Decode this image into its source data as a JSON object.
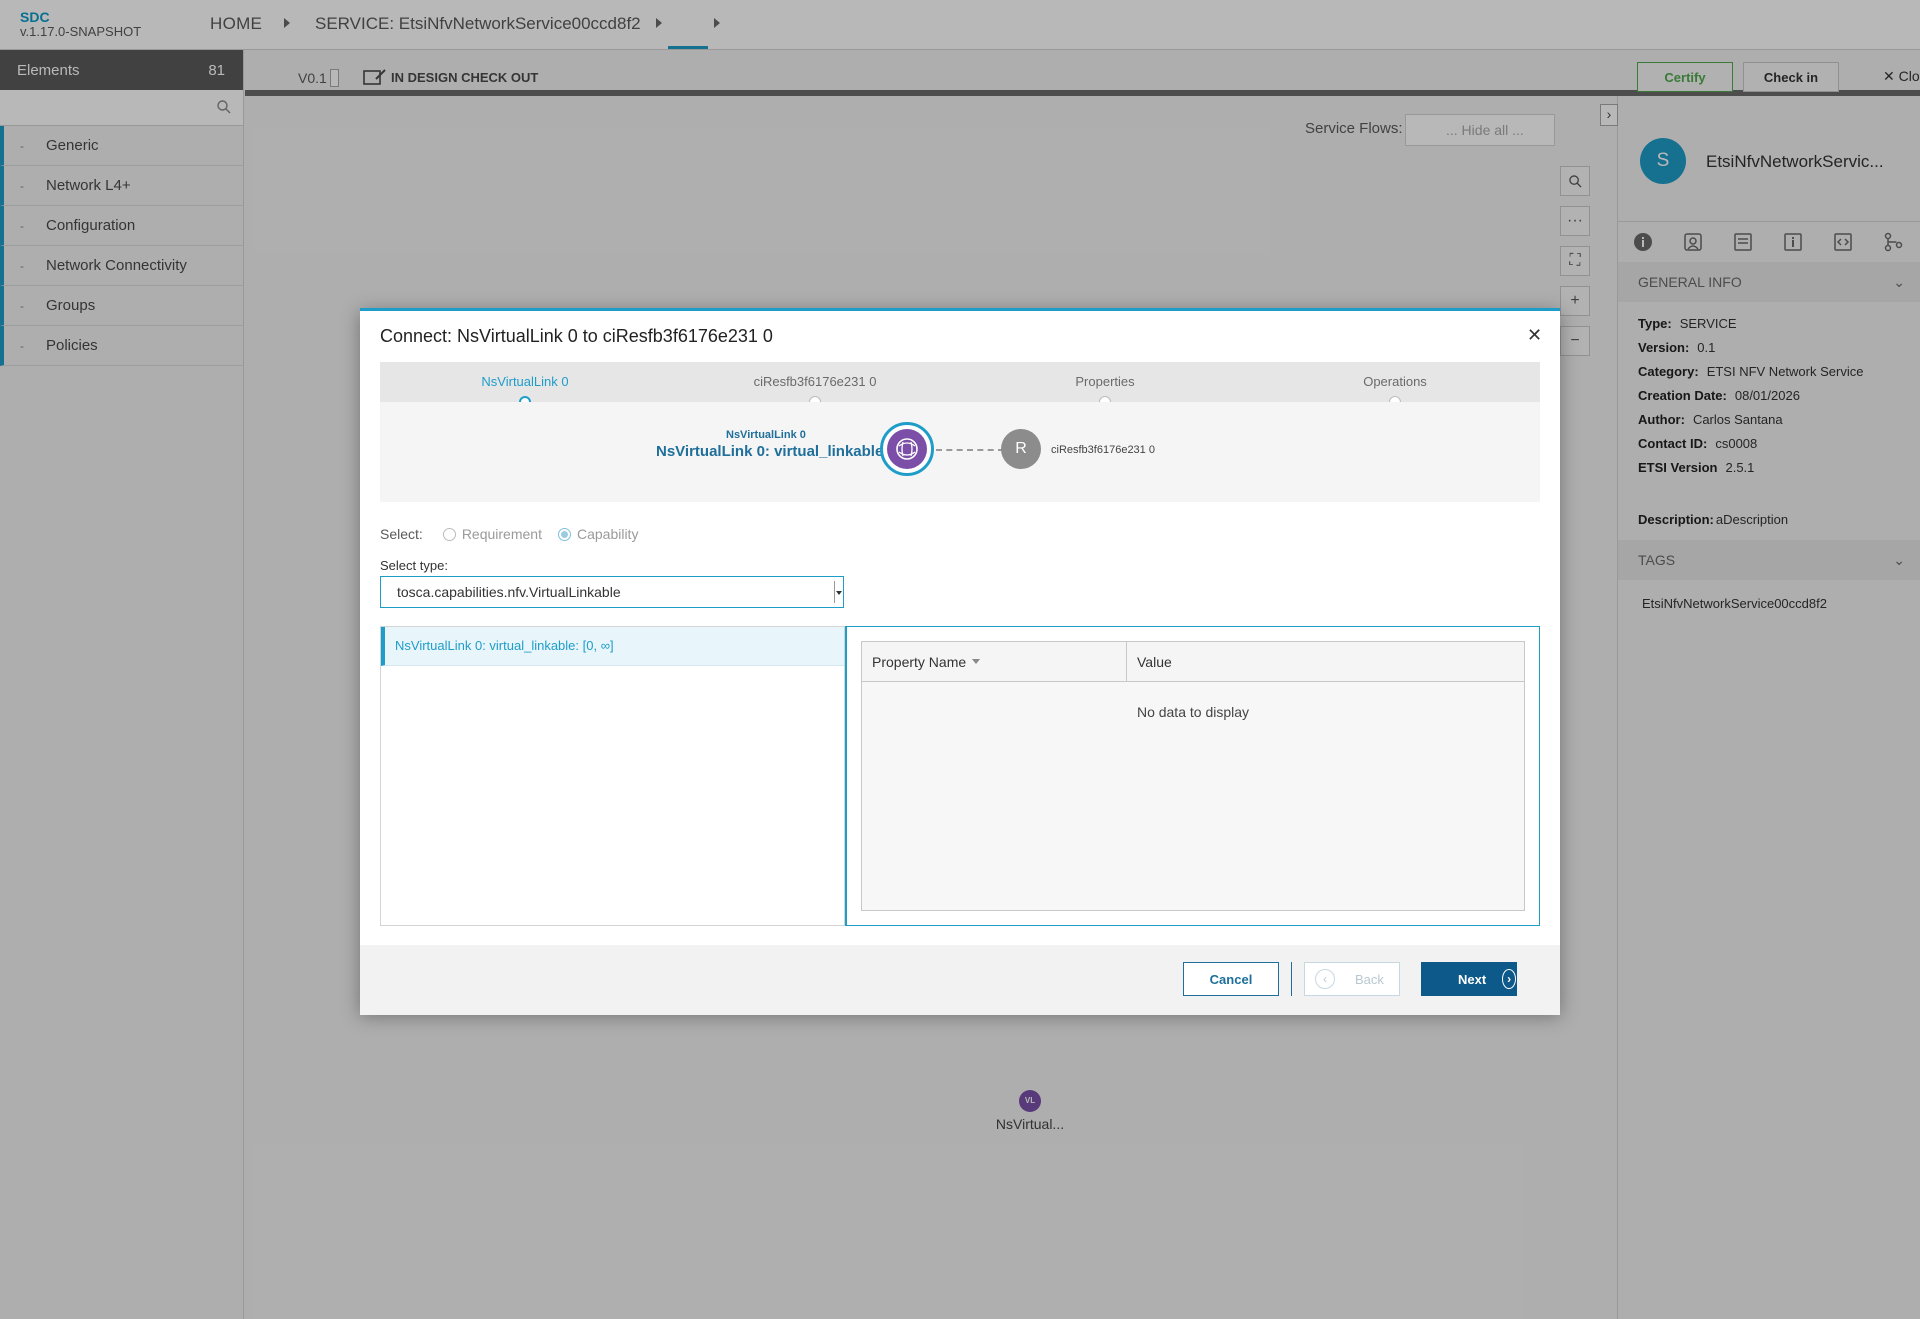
{
  "app": {
    "name": "SDC",
    "version": "v.1.17.0-SNAPSHOT"
  },
  "nav": {
    "home": "HOME",
    "service": "SERVICE: EtsiNfvNetworkService00ccd8f2"
  },
  "palette": {
    "title": "Elements",
    "count": "81",
    "search_placeholder": "",
    "items": [
      {
        "label": "Generic"
      },
      {
        "label": "Network L4+"
      },
      {
        "label": "Configuration"
      },
      {
        "label": "Network Connectivity"
      },
      {
        "label": "Groups"
      },
      {
        "label": "Policies"
      }
    ]
  },
  "subbar": {
    "version": "V0.1",
    "status": "IN DESIGN CHECK OUT",
    "certify": "Certify",
    "checkin": "Check in",
    "close": "Clo"
  },
  "canvas": {
    "service_flows_label": "Service Flows:",
    "service_flows_value": "... Hide all ...",
    "node_abbr": "VL",
    "node_name": "NsVirtual..."
  },
  "right_panel": {
    "avatar": "S",
    "title": "EtsiNfvNetworkServic...",
    "general_info_title": "GENERAL INFO",
    "info": [
      {
        "label": "Type:",
        "value": "SERVICE"
      },
      {
        "label": "Version:",
        "value": "0.1"
      },
      {
        "label": "Category:",
        "value": "ETSI NFV Network Service"
      },
      {
        "label": "Creation Date:",
        "value": "08/01/2026"
      },
      {
        "label": "Author:",
        "value": "Carlos Santana"
      },
      {
        "label": "Contact ID:",
        "value": "cs0008"
      },
      {
        "label": "ETSI Version",
        "value": "2.5.1"
      }
    ],
    "description_label": "Description:",
    "description_value": "aDescription",
    "tags_title": "TAGS",
    "tag": "EtsiNfvNetworkService00ccd8f2"
  },
  "modal": {
    "title": "Connect: NsVirtualLink 0 to ciResfb3f6176e231 0",
    "steps": [
      {
        "label": "NsVirtualLink 0"
      },
      {
        "label": "ciResfb3f6176e231 0"
      },
      {
        "label": "Properties"
      },
      {
        "label": "Operations"
      }
    ],
    "preview": {
      "from_small": "NsVirtualLink 0",
      "from_big": "NsVirtualLink 0: virtual_linkable",
      "to_initial": "R",
      "to_label": "ciResfb3f6176e231 0"
    },
    "select_label": "Select:",
    "requirement": "Requirement",
    "capability": "Capability",
    "select_type_label": "Select type:",
    "select_type_value": "tosca.capabilities.nfv.VirtualLinkable",
    "list_item": "NsVirtualLink 0: virtual_linkable: [0, ∞]",
    "table": {
      "col_name": "Property Name",
      "col_value": "Value",
      "empty": "No data to display"
    },
    "buttons": {
      "cancel": "Cancel",
      "back": "Back",
      "next": "Next"
    }
  }
}
